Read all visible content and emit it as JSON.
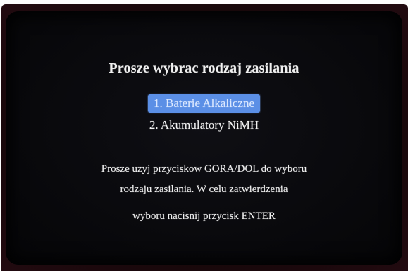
{
  "screen": {
    "title": "Prosze wybrac rodzaj zasilania",
    "options": [
      {
        "label": "1. Baterie Alkaliczne",
        "selected": true
      },
      {
        "label": "2. Akumulatory NiMH",
        "selected": false
      }
    ],
    "instructions": {
      "line1": "Prosze uzyj przyciskow GORA/DOL do wyboru",
      "line2": "rodzaju zasilania. W celu zatwierdzenia",
      "line3": "wyboru nacisnij przycisk ENTER"
    }
  },
  "colors": {
    "highlight": "#5b8fe6",
    "screen_bg": "#08080b",
    "text": "#f2f2f2"
  }
}
